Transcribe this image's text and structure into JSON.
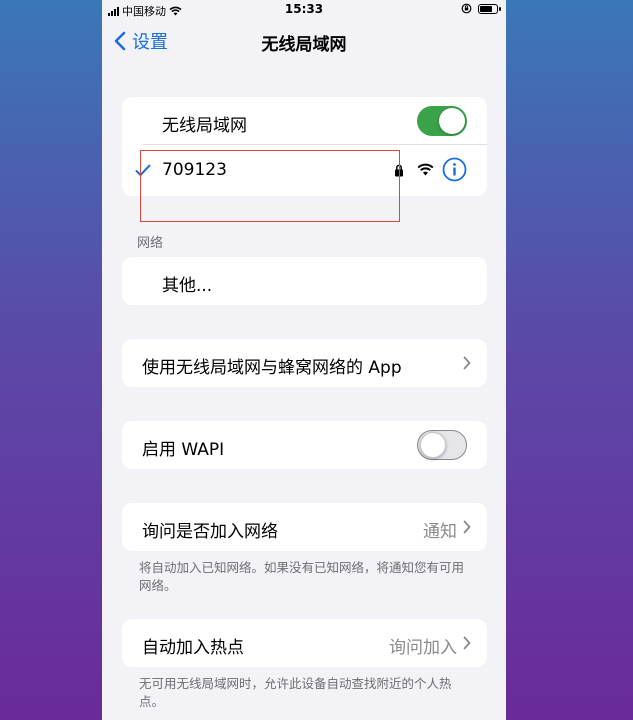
{
  "status_bar": {
    "carrier": "中国移动",
    "time": "15:33"
  },
  "nav": {
    "back_label": "设置",
    "title": "无线局域网"
  },
  "wifi_group": {
    "toggle_label": "无线局域网",
    "toggle_on": true,
    "connected_network": "709123"
  },
  "networks_section": {
    "header": "网络",
    "other_label": "其他..."
  },
  "app_usage": {
    "label": "使用无线局域网与蜂窝网络的 App"
  },
  "wapi": {
    "label": "启用 WAPI",
    "toggle_on": false
  },
  "ask_join": {
    "label": "询问是否加入网络",
    "value": "通知",
    "footnote": "将自动加入已知网络。如果没有已知网络，将通知您有可用网络。"
  },
  "auto_join_hotspot": {
    "label": "自动加入热点",
    "value": "询问加入",
    "footnote": "无可用无线局域网时，允许此设备自动查找附近的个人热点。"
  },
  "colors": {
    "accent": "#1a6fd9",
    "toggle_on": "#3aa349",
    "highlight_box": "#d8483b"
  }
}
